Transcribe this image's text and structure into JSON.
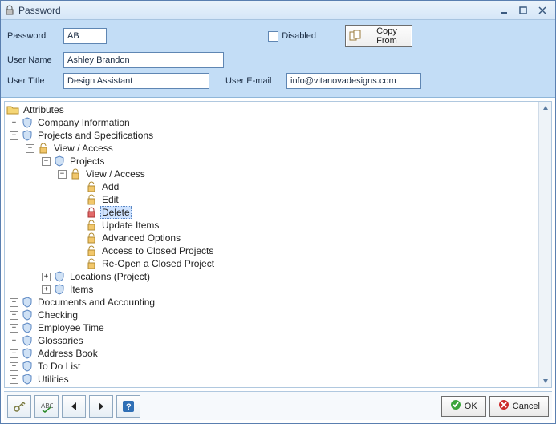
{
  "window": {
    "title": "Password"
  },
  "form": {
    "password_label": "Password",
    "password_value": "AB",
    "username_label": "User Name",
    "username_value": "Ashley Brandon",
    "usertitle_label": "User Title",
    "usertitle_value": "Design Assistant",
    "useremail_label": "User E-mail",
    "useremail_value": "info@vitanovadesigns.com",
    "disabled_label": "Disabled",
    "copy_from_label": "Copy From"
  },
  "tree": {
    "root_label": "Attributes",
    "nodes": [
      {
        "depth": 0,
        "exp": "plus",
        "icon": "shield",
        "label": "Company Information"
      },
      {
        "depth": 0,
        "exp": "minus",
        "icon": "shield",
        "label": "Projects and Specifications"
      },
      {
        "depth": 1,
        "exp": "minus",
        "icon": "lock-open",
        "label": "View / Access"
      },
      {
        "depth": 2,
        "exp": "minus",
        "icon": "shield",
        "label": "Projects"
      },
      {
        "depth": 3,
        "exp": "minus",
        "icon": "lock-open",
        "label": "View / Access"
      },
      {
        "depth": 4,
        "exp": "none",
        "icon": "lock-open",
        "label": "Add"
      },
      {
        "depth": 4,
        "exp": "none",
        "icon": "lock-open",
        "label": "Edit"
      },
      {
        "depth": 4,
        "exp": "none",
        "icon": "lock-closed",
        "label": "Delete",
        "selected": true
      },
      {
        "depth": 4,
        "exp": "none",
        "icon": "lock-open",
        "label": "Update Items"
      },
      {
        "depth": 4,
        "exp": "none",
        "icon": "lock-open",
        "label": "Advanced Options"
      },
      {
        "depth": 4,
        "exp": "none",
        "icon": "lock-open",
        "label": "Access to Closed Projects"
      },
      {
        "depth": 4,
        "exp": "none",
        "icon": "lock-open",
        "label": "Re-Open a Closed Project"
      },
      {
        "depth": 2,
        "exp": "plus",
        "icon": "shield",
        "label": "Locations (Project)"
      },
      {
        "depth": 2,
        "exp": "plus",
        "icon": "shield",
        "label": "Items"
      },
      {
        "depth": 0,
        "exp": "plus",
        "icon": "shield",
        "label": "Documents and Accounting"
      },
      {
        "depth": 0,
        "exp": "plus",
        "icon": "shield",
        "label": "Checking"
      },
      {
        "depth": 0,
        "exp": "plus",
        "icon": "shield",
        "label": "Employee Time"
      },
      {
        "depth": 0,
        "exp": "plus",
        "icon": "shield",
        "label": "Glossaries"
      },
      {
        "depth": 0,
        "exp": "plus",
        "icon": "shield",
        "label": "Address Book"
      },
      {
        "depth": 0,
        "exp": "plus",
        "icon": "shield",
        "label": "To Do List"
      },
      {
        "depth": 0,
        "exp": "plus",
        "icon": "shield",
        "label": "Utilities"
      }
    ]
  },
  "footer": {
    "ok_label": "OK",
    "cancel_label": "Cancel"
  }
}
